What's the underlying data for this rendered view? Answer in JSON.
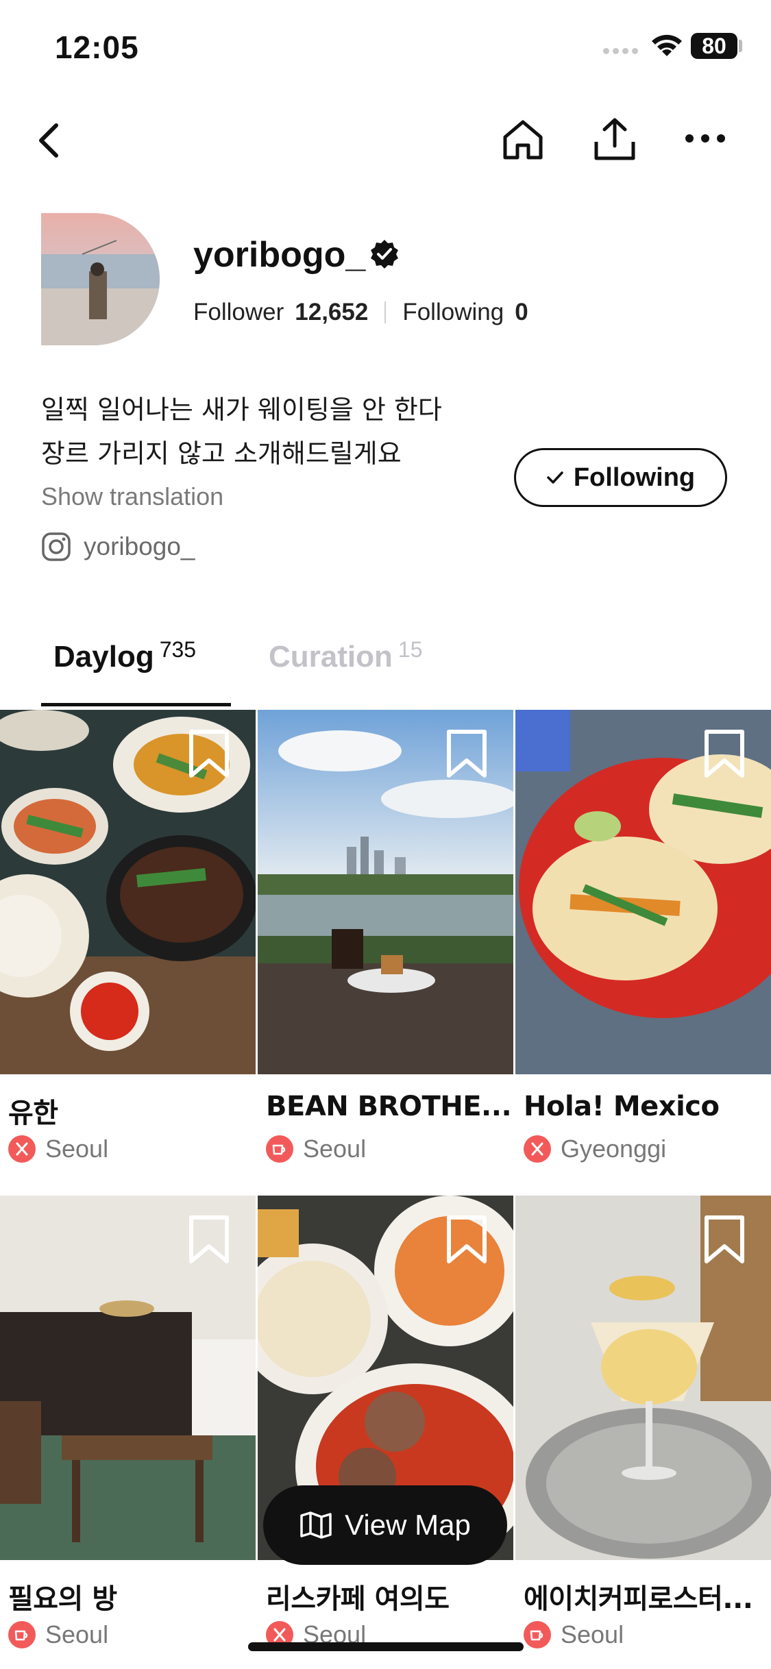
{
  "status": {
    "time": "12:05",
    "battery": "80"
  },
  "profile": {
    "username": "yoribogo_",
    "follower_label": "Follower",
    "follower_count": "12,652",
    "following_label": "Following",
    "following_count": "0",
    "bio_line1": "일찍 일어나는 새가 웨이팅을 안 한다",
    "bio_line2": "장르 가리지 않고 소개해드릴게요",
    "translate_label": "Show translation",
    "instagram_handle": "yoribogo_",
    "follow_button_label": "Following"
  },
  "tabs": [
    {
      "label": "Daylog",
      "count": "735"
    },
    {
      "label": "Curation",
      "count": "15"
    }
  ],
  "places": [
    {
      "name": "유한",
      "location": "Seoul",
      "category_icon": "restaurant-icon"
    },
    {
      "name": "BEAN BROTHE...",
      "location": "Seoul",
      "category_icon": "cafe-icon"
    },
    {
      "name": "Hola! Mexico",
      "location": "Gyeonggi",
      "category_icon": "restaurant-icon"
    },
    {
      "name": "필요의 방",
      "location": "Seoul",
      "category_icon": "cafe-icon"
    },
    {
      "name": "리스카페 여의도",
      "location": "Seoul",
      "category_icon": "restaurant-icon"
    },
    {
      "name": "에이치커피로스터...",
      "location": "Seoul",
      "category_icon": "cafe-icon"
    }
  ],
  "map_button_label": "View Map",
  "colors": {
    "accent": "#f25a5a",
    "text": "#111111",
    "muted": "#777777"
  }
}
